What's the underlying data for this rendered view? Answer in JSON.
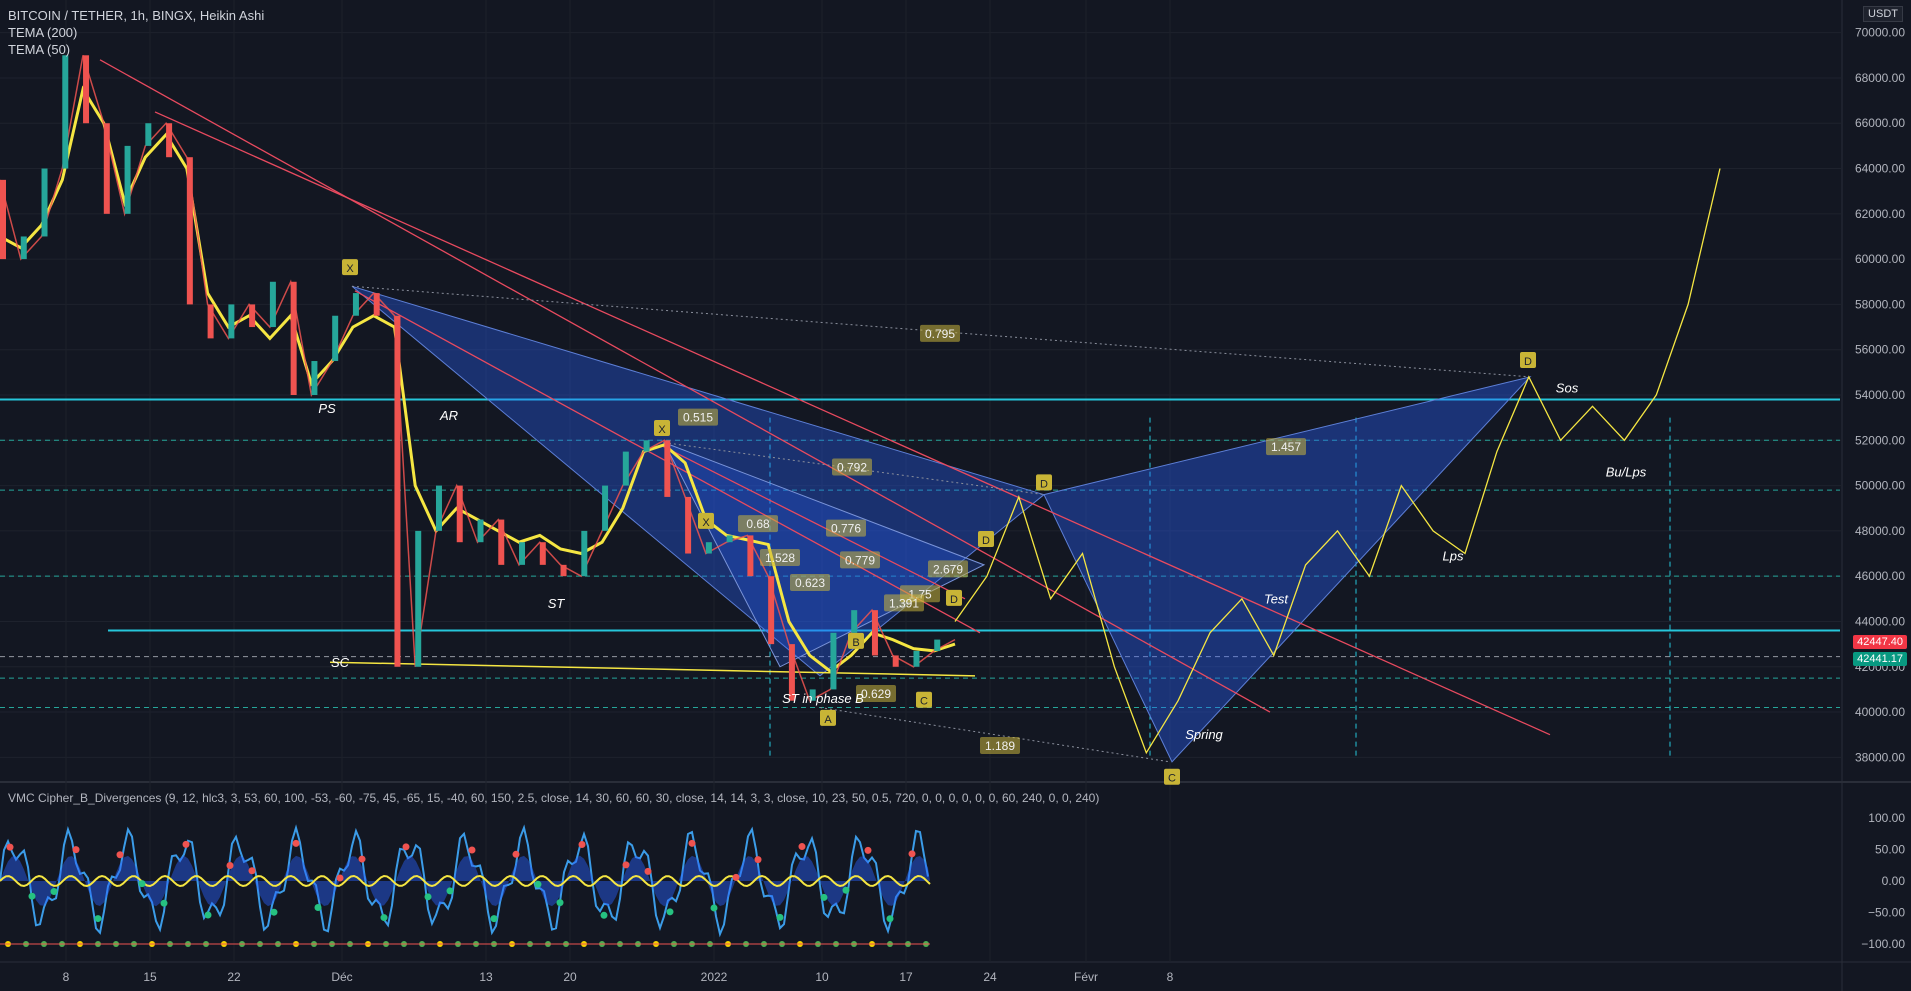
{
  "header": {
    "symbol_line": "BITCOIN / TETHER, 1h, BINGX, Heikin Ashi",
    "indicator_1": "TEMA (200)",
    "indicator_2": "TEMA (50)",
    "currency": "USDT"
  },
  "oscillator": {
    "legend": "VMC Cipher_B_Divergences (9, 12, hlc3, 3, 53, 60, 100, -53, -60, -75, 45, -65, 15, -40, 60, 150, 2.5, close, 14, 30, 60, 60, 30, close, 14, 14, 3, 3, close, 10, 23, 50, 0.5, 720, 0, 0, 0, 0, 0, 0, 60, 240, 0, 0, 240)",
    "ticks": [
      "100.00",
      "50.00",
      "0.00",
      "−50.00",
      "−100.00"
    ]
  },
  "price_tags": {
    "last_price": "42447.40",
    "last_price_color": "#f23645",
    "alt_price": "42441.17",
    "alt_price_color": "#089981"
  },
  "chart_data": {
    "type": "line",
    "title": "BITCOIN / TETHER, 1h, BINGX, Heikin Ashi",
    "ylim": [
      37000,
      71000
    ],
    "y_ticks": [
      "70000.00",
      "68000.00",
      "66000.00",
      "64000.00",
      "62000.00",
      "60000.00",
      "58000.00",
      "56000.00",
      "54000.00",
      "52000.00",
      "50000.00",
      "48000.00",
      "46000.00",
      "44000.00",
      "42000.00",
      "40000.00",
      "38000.00"
    ],
    "x_ticks": [
      "8",
      "15",
      "22",
      "Déc",
      "13",
      "20",
      "2022",
      "10",
      "17",
      "24",
      "Févr",
      "8"
    ],
    "series": [
      {
        "name": "TEMA (50)",
        "color": "#f5e642",
        "values": [
          61000,
          60500,
          61500,
          63500,
          67500,
          66000,
          62500,
          64500,
          65500,
          64000,
          58500,
          57000,
          57500,
          56500,
          57500,
          54500,
          55500,
          57000,
          57500,
          57000,
          50000,
          48000,
          49000,
          48500,
          48000,
          47500,
          47800,
          47200,
          47000,
          47500,
          49000,
          51500,
          51800,
          51000,
          48500,
          47800,
          47600,
          47400,
          44000,
          42500,
          41800,
          42500,
          43500,
          43200,
          42800,
          42700,
          43000
        ]
      },
      {
        "name": "price",
        "color": "#ef5350",
        "values": [
          63500,
          60000,
          61000,
          64000,
          69000,
          66000,
          62000,
          65000,
          66000,
          64500,
          58000,
          56500,
          58000,
          57000,
          59000,
          54000,
          55500,
          57500,
          58500,
          57500,
          42000,
          48000,
          50000,
          47500,
          48500,
          46500,
          47500,
          46500,
          46000,
          48000,
          50000,
          51500,
          52000,
          49500,
          47000,
          47500,
          47800,
          46000,
          43000,
          40500,
          41000,
          43500,
          44500,
          42500,
          42000,
          42700,
          43200
        ]
      }
    ],
    "projection": {
      "color": "#f5e642",
      "values": [
        44000,
        46000,
        49500,
        45000,
        47000,
        42000,
        38200,
        40500,
        43500,
        45000,
        42500,
        46500,
        48000,
        46000,
        50000,
        48000,
        47000,
        51500,
        54800,
        52000,
        53500,
        52000,
        54000,
        58000,
        64000
      ]
    },
    "levels": [
      53800,
      52000,
      49800,
      46000,
      43600,
      42447,
      41500,
      40200
    ],
    "pattern_labels": [
      "0.795",
      "0.515",
      "0.792",
      "1.457",
      "0.776",
      "0.779",
      "0.623",
      "1.528",
      "2.679",
      "1.75",
      "1.391",
      "0.629",
      "1.189",
      "0.68"
    ],
    "point_labels": [
      "X",
      "X",
      "X",
      "A",
      "B",
      "C",
      "D",
      "D",
      "D",
      "D",
      "C"
    ],
    "wyckoff_labels": [
      "PS",
      "AR",
      "SC",
      "ST",
      "ST in phase B",
      "Spring",
      "Test",
      "Lps",
      "Bu/Lps",
      "Sos"
    ]
  }
}
